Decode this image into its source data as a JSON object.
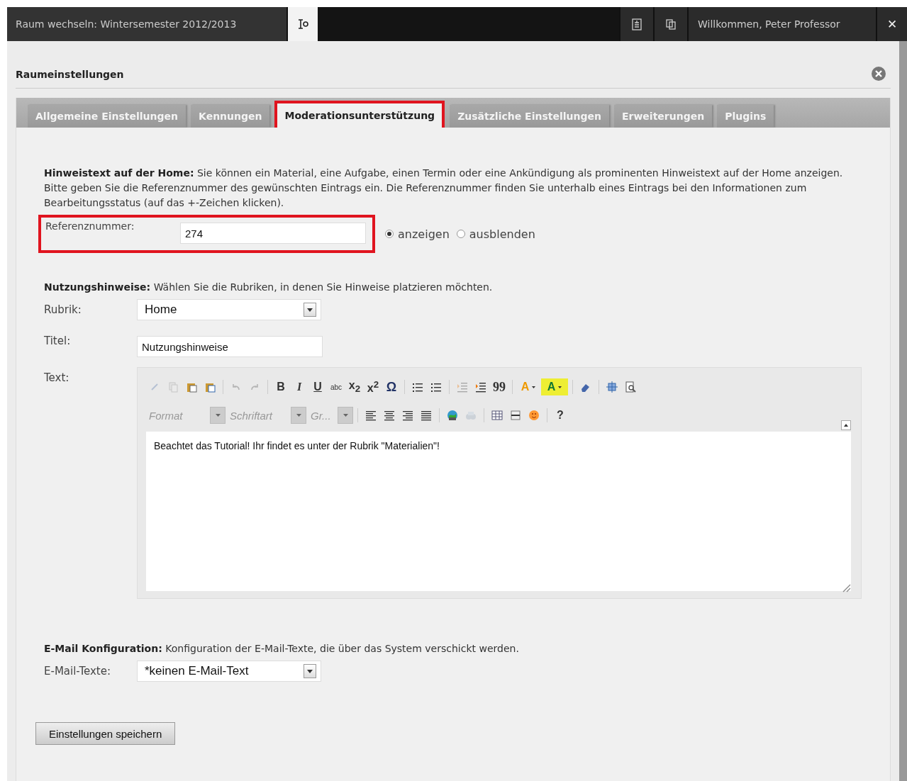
{
  "top_bar": {
    "room_switch": "Raum wechseln: Wintersemester 2012/2013",
    "welcome": "Willkommen, Peter Professor",
    "close": "✕"
  },
  "dialog": {
    "title": "Raumeinstellungen"
  },
  "tabs": [
    {
      "label": "Allgemeine Einstellungen",
      "selected": false,
      "highlighted": false
    },
    {
      "label": "Kennungen",
      "selected": false,
      "highlighted": false
    },
    {
      "label": "Moderationsunterstützung",
      "selected": true,
      "highlighted": true
    },
    {
      "label": "Zusätzliche Einstellungen",
      "selected": false,
      "highlighted": false
    },
    {
      "label": "Erweiterungen",
      "selected": false,
      "highlighted": false
    },
    {
      "label": "Plugins",
      "selected": false,
      "highlighted": false
    }
  ],
  "notice": {
    "intro": "**Hinweistext auf der Home:** Sie können ein Material, eine Aufgabe, einen Termin oder eine Ankündigung als prominenten Hinweistext auf der Home anzeigen. Bitte geben Sie die Referenznummer des gewünschten Eintrags ein. Die Referenznummer finden Sie unterhalb eines Eintrags bei den Informationen zum Bearbeitungsstatus (auf das +-Zeichen klicken).",
    "field_label": "Referenznummer:",
    "value": "274",
    "highlighted": true,
    "options": [
      {
        "label": "anzeigen",
        "selected": true
      },
      {
        "label": "ausblenden",
        "selected": false
      }
    ]
  },
  "usage": {
    "intro": "**Nutzungshinweise:** Wählen Sie die Rubriken, in denen Sie Hinweise platzieren möchten.",
    "rubric_label": "Rubrik:",
    "rubric_value": "Home",
    "title_label": "Titel:",
    "title_value": "Nutzungshinweise",
    "text_label": "Text:",
    "toolbar_rows": [
      [
        {
          "kind": "icon",
          "disabled": true
        },
        {
          "kind": "icon",
          "disabled": true
        },
        {
          "kind": "icon",
          "disabled": false
        },
        {
          "kind": "icon",
          "disabled": false
        },
        {
          "kind": "sep"
        },
        {
          "kind": "icon",
          "disabled": true
        },
        {
          "kind": "icon",
          "disabled": true
        },
        {
          "kind": "sep"
        },
        {
          "kind": "glyph",
          "label": "B",
          "disabled": false
        },
        {
          "kind": "glyph",
          "label": "I",
          "disabled": false
        },
        {
          "kind": "glyph",
          "label": "U",
          "disabled": false
        },
        {
          "kind": "glyph",
          "label": "abc",
          "disabled": false
        },
        {
          "kind": "glyph",
          "label": "x$_{2}$",
          "disabled": false
        },
        {
          "kind": "glyph",
          "label": "x$^{2}$",
          "disabled": false
        },
        {
          "kind": "glyph",
          "label": "Ω",
          "disabled": false
        },
        {
          "kind": "sep"
        },
        {
          "kind": "icon",
          "disabled": false
        },
        {
          "kind": "icon",
          "disabled": false
        },
        {
          "kind": "sep"
        },
        {
          "kind": "icon",
          "disabled": true
        },
        {
          "kind": "icon",
          "disabled": false
        },
        {
          "kind": "glyph",
          "label": "99",
          "disabled": false
        },
        {
          "kind": "sep"
        },
        {
          "kind": "color",
          "label": "A",
          "disabled": false
        },
        {
          "kind": "color",
          "label": "A",
          "disabled": false
        },
        {
          "kind": "sep"
        },
        {
          "kind": "icon",
          "disabled": false
        },
        {
          "kind": "sep"
        },
        {
          "kind": "icon",
          "disabled": false
        },
        {
          "kind": "icon",
          "disabled": false
        }
      ],
      [
        {
          "kind": "combo",
          "label": "Format",
          "disabled": true
        },
        {
          "kind": "combo",
          "label": "Schriftart",
          "disabled": true
        },
        {
          "kind": "combo",
          "label": "Gr...",
          "disabled": true
        },
        {
          "kind": "sep"
        },
        {
          "kind": "icon",
          "disabled": false
        },
        {
          "kind": "icon",
          "disabled": false
        },
        {
          "kind": "icon",
          "disabled": false
        },
        {
          "kind": "icon",
          "disabled": false
        },
        {
          "kind": "sep"
        },
        {
          "kind": "icon",
          "disabled": false
        },
        {
          "kind": "icon",
          "disabled": true
        },
        {
          "kind": "sep"
        },
        {
          "kind": "icon",
          "disabled": false
        },
        {
          "kind": "icon",
          "disabled": false
        },
        {
          "kind": "icon",
          "disabled": false
        },
        {
          "kind": "sep"
        },
        {
          "kind": "glyph",
          "label": "?",
          "disabled": false
        }
      ]
    ],
    "text_value": "Beachtet das Tutorial! Ihr findet es unter der Rubrik \"Materialien\"!"
  },
  "email": {
    "intro": "**E-Mail Konfiguration:** Konfiguration der E-Mail-Texte, die über das System verschickt werden.",
    "label": "E-Mail-Texte:",
    "value": "*keinen E-Mail-Text"
  },
  "save_button": "Einstellungen speichern"
}
